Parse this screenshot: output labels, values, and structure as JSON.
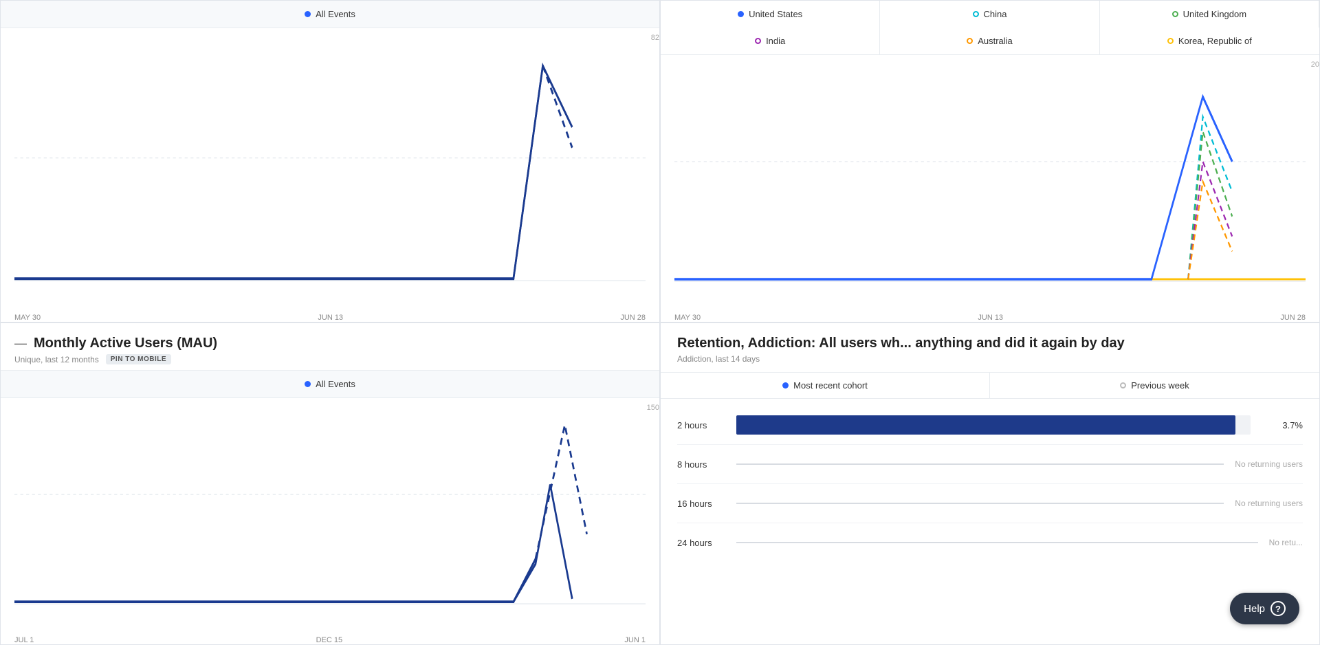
{
  "topLeft": {
    "header": "All Events",
    "dot": "blue",
    "xLabels": [
      "MAY 30",
      "JUN 13",
      "JUN 28"
    ],
    "yMax": 82,
    "chartId": "top-left-chart"
  },
  "topRight": {
    "legend": [
      {
        "label": "United States",
        "dotClass": "dot-blue",
        "color": "#2962ff"
      },
      {
        "label": "China",
        "dotClass": "dot-teal",
        "color": "#00bcd4"
      },
      {
        "label": "United Kingdom",
        "dotClass": "dot-green",
        "color": "#4caf50"
      },
      {
        "label": "India",
        "dotClass": "dot-purple",
        "color": "#9c27b0"
      },
      {
        "label": "Australia",
        "dotClass": "dot-orange",
        "color": "#ff9800"
      },
      {
        "label": "Korea, Republic of",
        "dotClass": "dot-yellow",
        "color": "#ffc107"
      }
    ],
    "xLabels": [
      "MAY 30",
      "JUN 13",
      "JUN 28"
    ],
    "yMax": 20
  },
  "bottomLeft": {
    "title": "Monthly Active Users (MAU)",
    "subtitle": "Unique, last 12 months",
    "pinLabel": "PIN TO MOBILE",
    "header": "All Events",
    "dot": "blue",
    "xLabels": [
      "JUL 1",
      "DEC 15",
      "JUN 1"
    ],
    "yMax": 150
  },
  "bottomRight": {
    "title": "Retention, Addiction: All users wh... anything and did it again by day",
    "subtitle": "Addiction, last 14 days",
    "tabs": [
      {
        "label": "Most recent cohort",
        "active": true
      },
      {
        "label": "Previous week",
        "active": false
      }
    ],
    "rows": [
      {
        "label": "2 hours",
        "hasBar": true,
        "barWidth": 97,
        "value": "3.7%",
        "noUsers": false
      },
      {
        "label": "8 hours",
        "hasBar": false,
        "value": "",
        "noUsers": true,
        "noUsersText": "No returning users"
      },
      {
        "label": "16 hours",
        "hasBar": false,
        "value": "",
        "noUsers": true,
        "noUsersText": "No returning users"
      },
      {
        "label": "24 hours",
        "hasBar": false,
        "value": "",
        "noUsers": true,
        "noUsersText": "No retu..."
      }
    ]
  },
  "help": {
    "label": "Help",
    "icon": "?"
  }
}
